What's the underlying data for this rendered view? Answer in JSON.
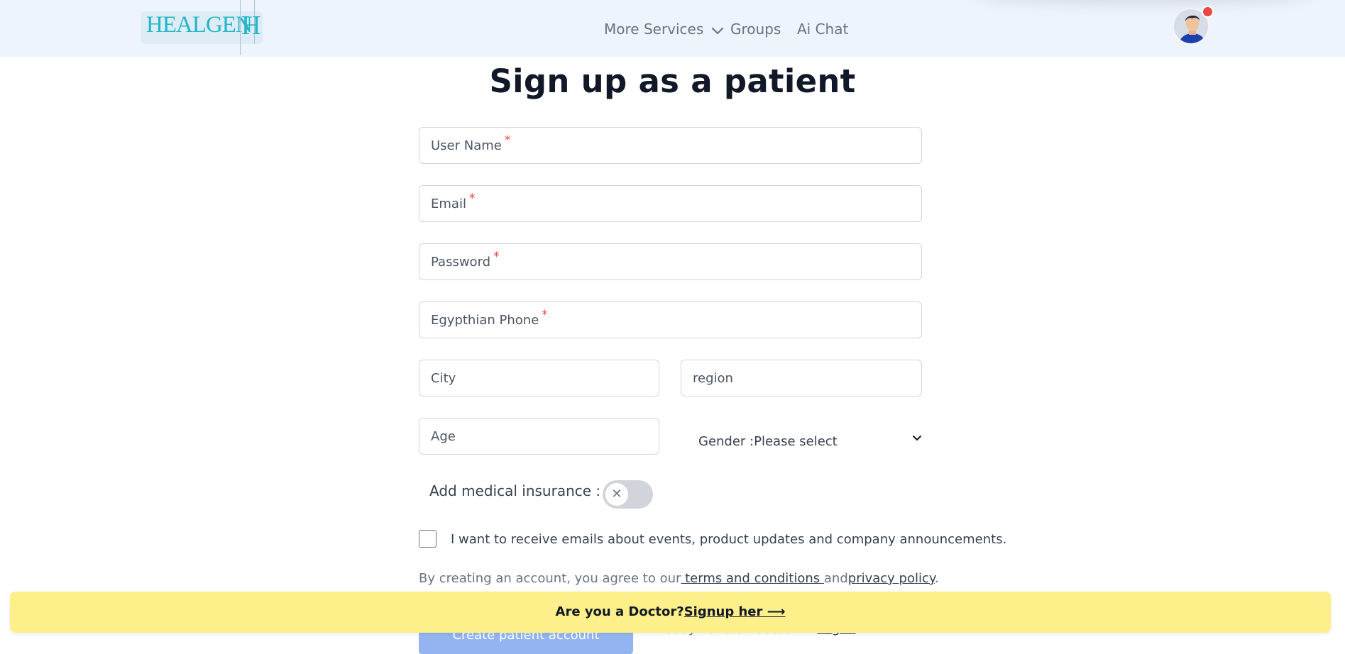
{
  "brand": {
    "logo_text": "HEALGEN",
    "logo_mark": "H"
  },
  "nav": {
    "more_services": "More Services",
    "groups": "Groups",
    "ai_chat": "Ai Chat"
  },
  "page": {
    "title": "Sign up as a patient"
  },
  "form": {
    "username_label": "User Name",
    "email_label": "Email",
    "password_label": "Password",
    "phone_label": "Egypthian Phone",
    "required_mark": "*",
    "city_label": "City",
    "region_label": "region",
    "age_label": "Age",
    "gender_select": "Gender :Please select",
    "insurance_label": "Add medical insurance :",
    "insurance_enabled": false,
    "emails_opt_in_label": "I want to receive emails about events, product updates and company announcements.",
    "emails_opt_in_checked": false,
    "terms_prefix": "By creating an account, you agree to our",
    "terms_link": " terms and conditions ",
    "terms_and": "and",
    "privacy_link": "privacy policy",
    "terms_suffix": ".",
    "submit_label": "Create patient account",
    "already_text": "Already have an account?",
    "login_link": "Log in"
  },
  "banner": {
    "question": "Are you a Doctor?",
    "link": "Signup her ",
    "arrow": "⟶"
  },
  "colors": {
    "navbar_bg": "#eef4fc",
    "brand": "#21b6c9",
    "banner_bg": "#fdf08a",
    "required": "#ef4444",
    "submit_bg": "#93b4f1"
  }
}
